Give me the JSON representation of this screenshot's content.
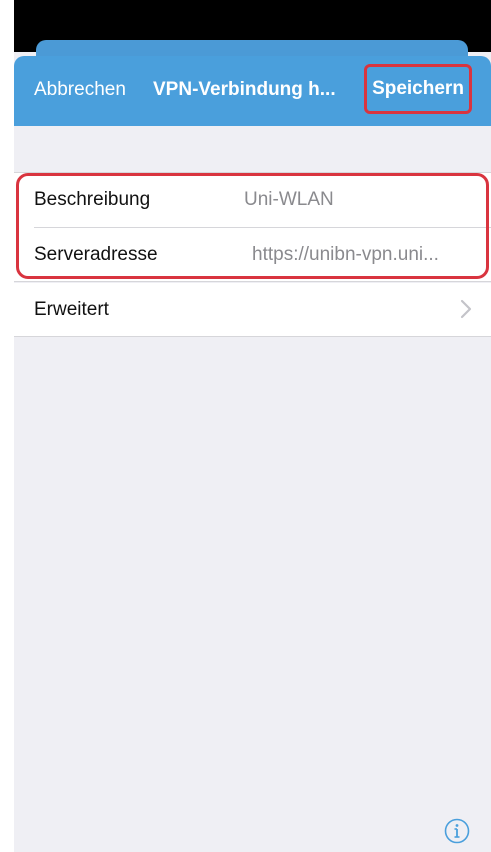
{
  "navbar": {
    "cancel_label": "Abbrechen",
    "title": "VPN-Verbindung h...",
    "save_label": "Speichern"
  },
  "form": {
    "description_label": "Beschreibung",
    "description_value": "Uni-WLAN",
    "server_label": "Serveradresse",
    "server_value": "https://unibn-vpn.uni..."
  },
  "advanced": {
    "label": "Erweitert",
    "icon": "chevron-right-icon"
  },
  "footer": {
    "info_icon": "info-icon"
  },
  "colors": {
    "navbar": "#4a9fdc",
    "highlight": "#d9343f",
    "background": "#efeff4",
    "secondary_text": "#8a8a8e"
  }
}
